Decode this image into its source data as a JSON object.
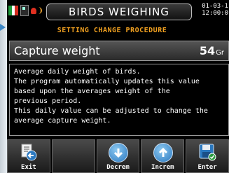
{
  "header": {
    "title": "BIRDS WEIGHING",
    "date": "01-03-1",
    "time": "12:00:0"
  },
  "flag_colors": [
    "#1e9a3a",
    "#ffffff",
    "#d52b1e"
  ],
  "subtitle": "SETTING CHANGE PROCEDURE",
  "parameter": {
    "label": "Capture weight",
    "value": "54",
    "unit": "Gr"
  },
  "description": [
    "Average daily weight of birds.",
    "The program automatically updates this value",
    "based upon the averages weight of the",
    "previous period.",
    "This daily value can be adjusted to change the",
    "average capture weight."
  ],
  "toolbar": {
    "exit": {
      "label": "Exit",
      "icon": "exit-icon"
    },
    "empty": {
      "label": ""
    },
    "decrement": {
      "label": "Decrem",
      "icon": "down-arrow-icon"
    },
    "increment": {
      "label": "Increm",
      "icon": "up-arrow-icon"
    },
    "enter": {
      "label": "Enter",
      "icon": "save-icon"
    }
  }
}
